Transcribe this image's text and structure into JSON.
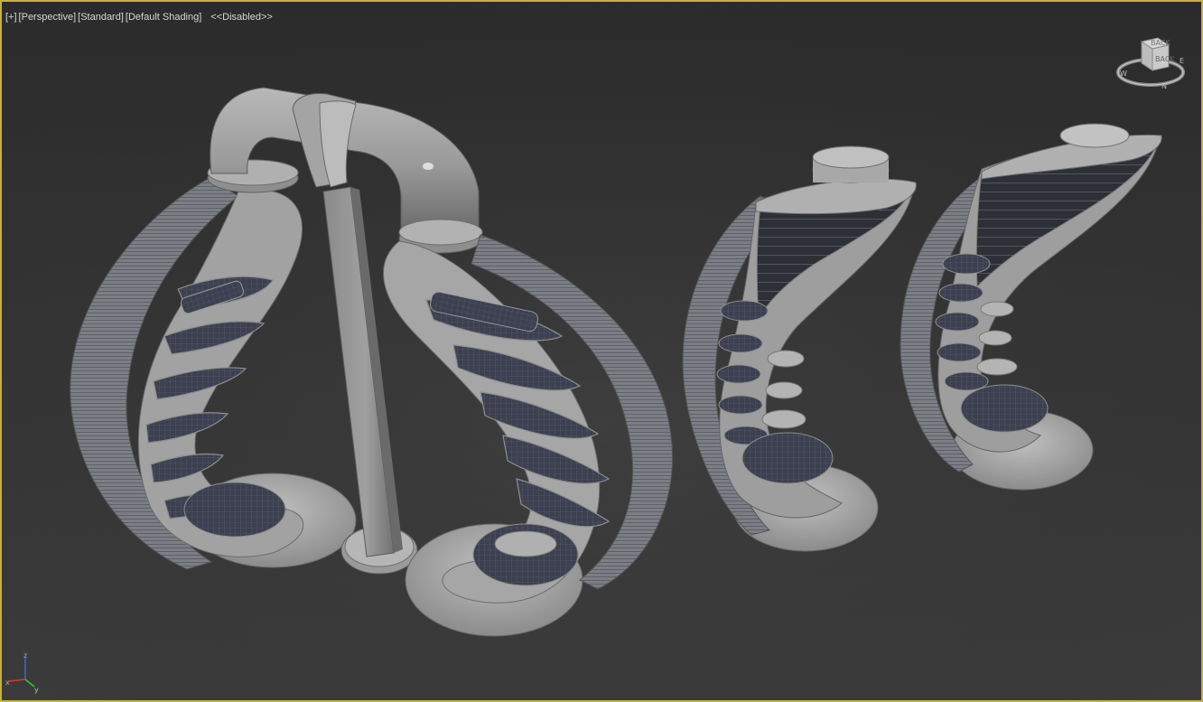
{
  "viewport": {
    "label_plus": "[+]",
    "label_view": "[Perspective]",
    "label_style": "[Standard]",
    "label_shading": "[Default Shading]",
    "label_status": "<<Disabled>>",
    "border_color": "#c8b040"
  },
  "viewcube": {
    "face_top": "BACK",
    "face_upper": "BACK",
    "compass_w": "W",
    "compass_n": "N",
    "compass_e": "E"
  },
  "axis": {
    "x": "x",
    "y": "y",
    "z": "z",
    "x_color": "#d23a3a",
    "y_color": "#3ac23a",
    "z_color": "#3a6ad2"
  },
  "scene": {
    "objects": [
      "tower-left-pair",
      "connecting-pipe",
      "support-pillar",
      "tower-middle",
      "tower-right"
    ]
  }
}
